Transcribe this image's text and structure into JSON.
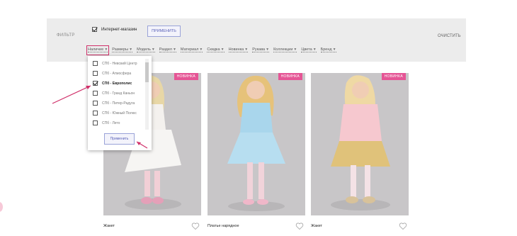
{
  "filter_bar": {
    "label": "ФИЛЬТР",
    "online_store": "Интернет-магазин",
    "apply_label": "ПРИМЕНИТЬ",
    "clear_label": "ОЧИСТИТЬ",
    "filters": [
      "Наличие",
      "Размеры",
      "Модель",
      "Раздел",
      "Материал",
      "Скидка",
      "Новинка",
      "Рукава",
      "Коллекции",
      "Цвета",
      "Бренд"
    ]
  },
  "dropdown": {
    "items": [
      {
        "label": "СПб - Невский Центр",
        "checked": false
      },
      {
        "label": "СПб - Атмосфера",
        "checked": false
      },
      {
        "label": "СПб - Европолис",
        "checked": true
      },
      {
        "label": "СПб - Гранд Каньон",
        "checked": false
      },
      {
        "label": "СПб - Питер-Радуга",
        "checked": false
      },
      {
        "label": "СПб - Южный Полюс",
        "checked": false
      },
      {
        "label": "СПб - Лето",
        "checked": false
      }
    ],
    "apply_label": "Применить"
  },
  "products": [
    {
      "badge": "НОВИНКА",
      "name": "Жакет"
    },
    {
      "badge": "НОВИНКА",
      "name": "Платье нарядное"
    },
    {
      "badge": "НОВИНКА",
      "name": "Жакет"
    }
  ],
  "colors": {
    "accent": "#d0306a",
    "badge": "#e55595",
    "button_border": "#9aa3d8",
    "filter_bg": "#ececec"
  }
}
